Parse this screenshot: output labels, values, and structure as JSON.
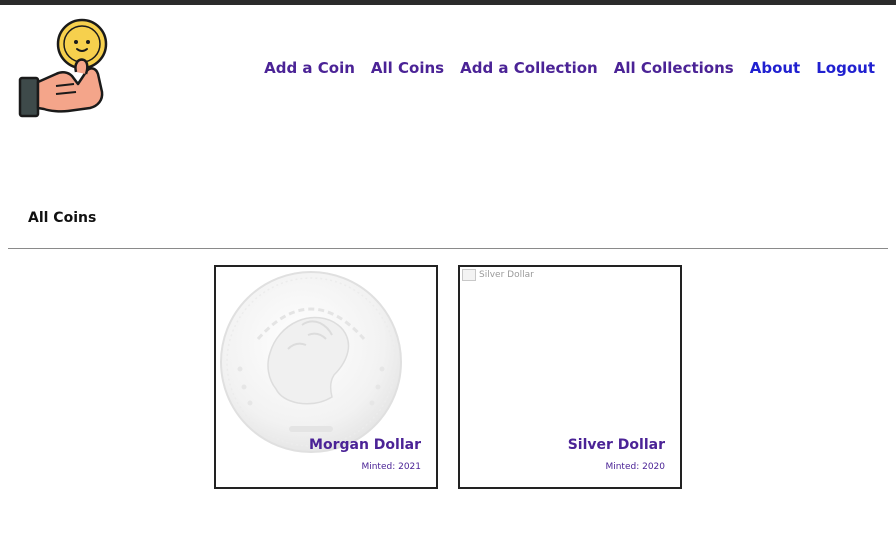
{
  "nav": {
    "items": [
      {
        "label": "Add a Coin",
        "color": "#4b2396"
      },
      {
        "label": "All Coins",
        "color": "#4b2396"
      },
      {
        "label": "Add a Collection",
        "color": "#4b2396"
      },
      {
        "label": "All Collections",
        "color": "#4b2396"
      },
      {
        "label": "About",
        "color": "#2020d0"
      },
      {
        "label": "Logout",
        "color": "#2020d0"
      }
    ]
  },
  "logo": {
    "icon": "hand-holding-coin-icon"
  },
  "page": {
    "heading": "All Coins"
  },
  "coins": [
    {
      "name": "Morgan Dollar",
      "minted": "Minted: 2021",
      "image": "morgan-dollar-coin-icon",
      "image_alt": ""
    },
    {
      "name": "Silver Dollar",
      "minted": "Minted: 2020",
      "image": "broken-image-icon",
      "image_alt": "Silver Dollar"
    }
  ],
  "colors": {
    "accent": "#4b2396",
    "link": "#2020d0",
    "coin_yellow": "#f6d04d",
    "hand_skin": "#f4a58a"
  }
}
